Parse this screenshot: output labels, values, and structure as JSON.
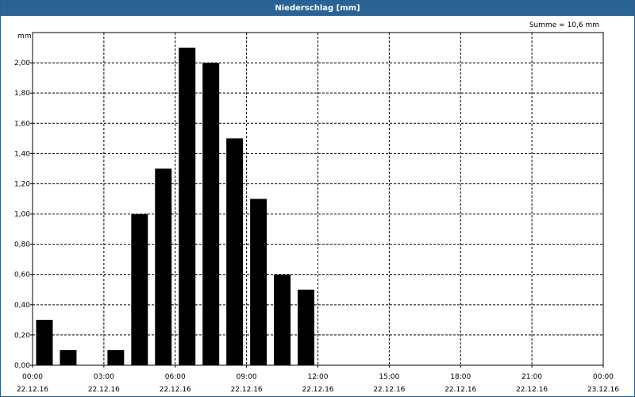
{
  "window": {
    "title": "Niederschlag [mm]"
  },
  "chart_data": {
    "type": "bar",
    "title": "Niederschlag [mm]",
    "ylabel": "mm",
    "annotation": "Summe = 10,6 mm",
    "ylim": [
      0,
      2.2
    ],
    "y_ticks": [
      "0,00",
      "0,20",
      "0,40",
      "0,60",
      "0,80",
      "1,00",
      "1,20",
      "1,40",
      "1,60",
      "1,80",
      "2,00"
    ],
    "x_ticks": [
      {
        "time": "00:00",
        "date": "22.12.16"
      },
      {
        "time": "03:00",
        "date": "22.12.16"
      },
      {
        "time": "06:00",
        "date": "22.12.16"
      },
      {
        "time": "09:00",
        "date": "22.12.16"
      },
      {
        "time": "12:00",
        "date": "22.12.16"
      },
      {
        "time": "15:00",
        "date": "22.12.16"
      },
      {
        "time": "18:00",
        "date": "22.12.16"
      },
      {
        "time": "21:00",
        "date": "22.12.16"
      },
      {
        "time": "00:00",
        "date": "23.12.16"
      }
    ],
    "x_range_hours": [
      0,
      24
    ],
    "bar_color": "#000000",
    "grid": true,
    "categories": [
      "00:00",
      "01:00",
      "02:00",
      "03:00",
      "04:00",
      "05:00",
      "06:00",
      "07:00",
      "08:00",
      "09:00",
      "10:00",
      "11:00"
    ],
    "values": [
      0.3,
      0.1,
      0.0,
      0.1,
      1.0,
      1.3,
      2.1,
      2.0,
      1.5,
      1.1,
      0.6,
      0.5
    ]
  }
}
